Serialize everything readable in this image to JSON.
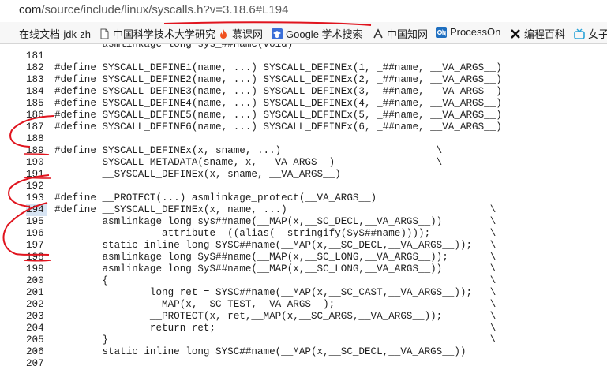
{
  "address_bar": {
    "url_prefix": "com",
    "url_rest": "/source/include/linux/syscalls.h?v=3.18.6#L194"
  },
  "bookmarks": [
    {
      "label": "在线文档-jdk-zh",
      "icon": "none"
    },
    {
      "label": "中国科学技术大学研究",
      "icon": "page-icon"
    },
    {
      "label": "慕课网",
      "icon": "flame-icon"
    },
    {
      "label": "Google 学术搜索",
      "icon": "scholar-icon"
    },
    {
      "label": "中国知网",
      "icon": "cnki-icon"
    },
    {
      "label": "ProcessOn",
      "icon": "on-icon"
    },
    {
      "label": "编程百科",
      "icon": "x-icon"
    },
    {
      "label": "女子",
      "icon": "tv-icon"
    }
  ],
  "code": {
    "highlighted_line": "194",
    "lines": [
      {
        "n": "",
        "text": "        asmlinkage long sys_##name(void)"
      },
      {
        "n": "181",
        "text": ""
      },
      {
        "n": "182",
        "text": "#define SYSCALL_DEFINE1(name, ...) SYSCALL_DEFINEx(1, _##name, __VA_ARGS__)"
      },
      {
        "n": "183",
        "text": "#define SYSCALL_DEFINE2(name, ...) SYSCALL_DEFINEx(2, _##name, __VA_ARGS__)"
      },
      {
        "n": "184",
        "text": "#define SYSCALL_DEFINE3(name, ...) SYSCALL_DEFINEx(3, _##name, __VA_ARGS__)"
      },
      {
        "n": "185",
        "text": "#define SYSCALL_DEFINE4(name, ...) SYSCALL_DEFINEx(4, _##name, __VA_ARGS__)"
      },
      {
        "n": "186",
        "text": "#define SYSCALL_DEFINE5(name, ...) SYSCALL_DEFINEx(5, _##name, __VA_ARGS__)"
      },
      {
        "n": "187",
        "text": "#define SYSCALL_DEFINE6(name, ...) SYSCALL_DEFINEx(6, _##name, __VA_ARGS__)"
      },
      {
        "n": "188",
        "text": ""
      },
      {
        "n": "189",
        "text": "#define SYSCALL_DEFINEx(x, sname, ...)                          \\"
      },
      {
        "n": "190",
        "text": "        SYSCALL_METADATA(sname, x, __VA_ARGS__)                 \\"
      },
      {
        "n": "191",
        "text": "        __SYSCALL_DEFINEx(x, sname, __VA_ARGS__)"
      },
      {
        "n": "192",
        "text": ""
      },
      {
        "n": "193",
        "text": "#define __PROTECT(...) asmlinkage_protect(__VA_ARGS__)"
      },
      {
        "n": "194",
        "text": "#define __SYSCALL_DEFINEx(x, name, ...)                                  \\"
      },
      {
        "n": "195",
        "text": "        asmlinkage long sys##name(__MAP(x,__SC_DECL,__VA_ARGS__))        \\"
      },
      {
        "n": "196",
        "text": "                __attribute__((alias(__stringify(SyS##name))));          \\"
      },
      {
        "n": "197",
        "text": "        static inline long SYSC##name(__MAP(x,__SC_DECL,__VA_ARGS__));   \\"
      },
      {
        "n": "198",
        "text": "        asmlinkage long SyS##name(__MAP(x,__SC_LONG,__VA_ARGS__));       \\"
      },
      {
        "n": "199",
        "text": "        asmlinkage long SyS##name(__MAP(x,__SC_LONG,__VA_ARGS__))        \\"
      },
      {
        "n": "200",
        "text": "        {                                                                \\"
      },
      {
        "n": "201",
        "text": "                long ret = SYSC##name(__MAP(x,__SC_CAST,__VA_ARGS__));   \\"
      },
      {
        "n": "202",
        "text": "                __MAP(x,__SC_TEST,__VA_ARGS__);                          \\"
      },
      {
        "n": "203",
        "text": "                __PROTECT(x, ret,__MAP(x,__SC_ARGS,__VA_ARGS__));        \\"
      },
      {
        "n": "204",
        "text": "                return ret;                                              \\"
      },
      {
        "n": "205",
        "text": "        }                                                                \\"
      },
      {
        "n": "206",
        "text": "        static inline long SYSC##name(__MAP(x,__SC_DECL,__VA_ARGS__))"
      },
      {
        "n": "207",
        "text": ""
      }
    ]
  },
  "colors": {
    "annotation_ink": "#e0141e",
    "line_highlight": "#d7e4f3"
  }
}
